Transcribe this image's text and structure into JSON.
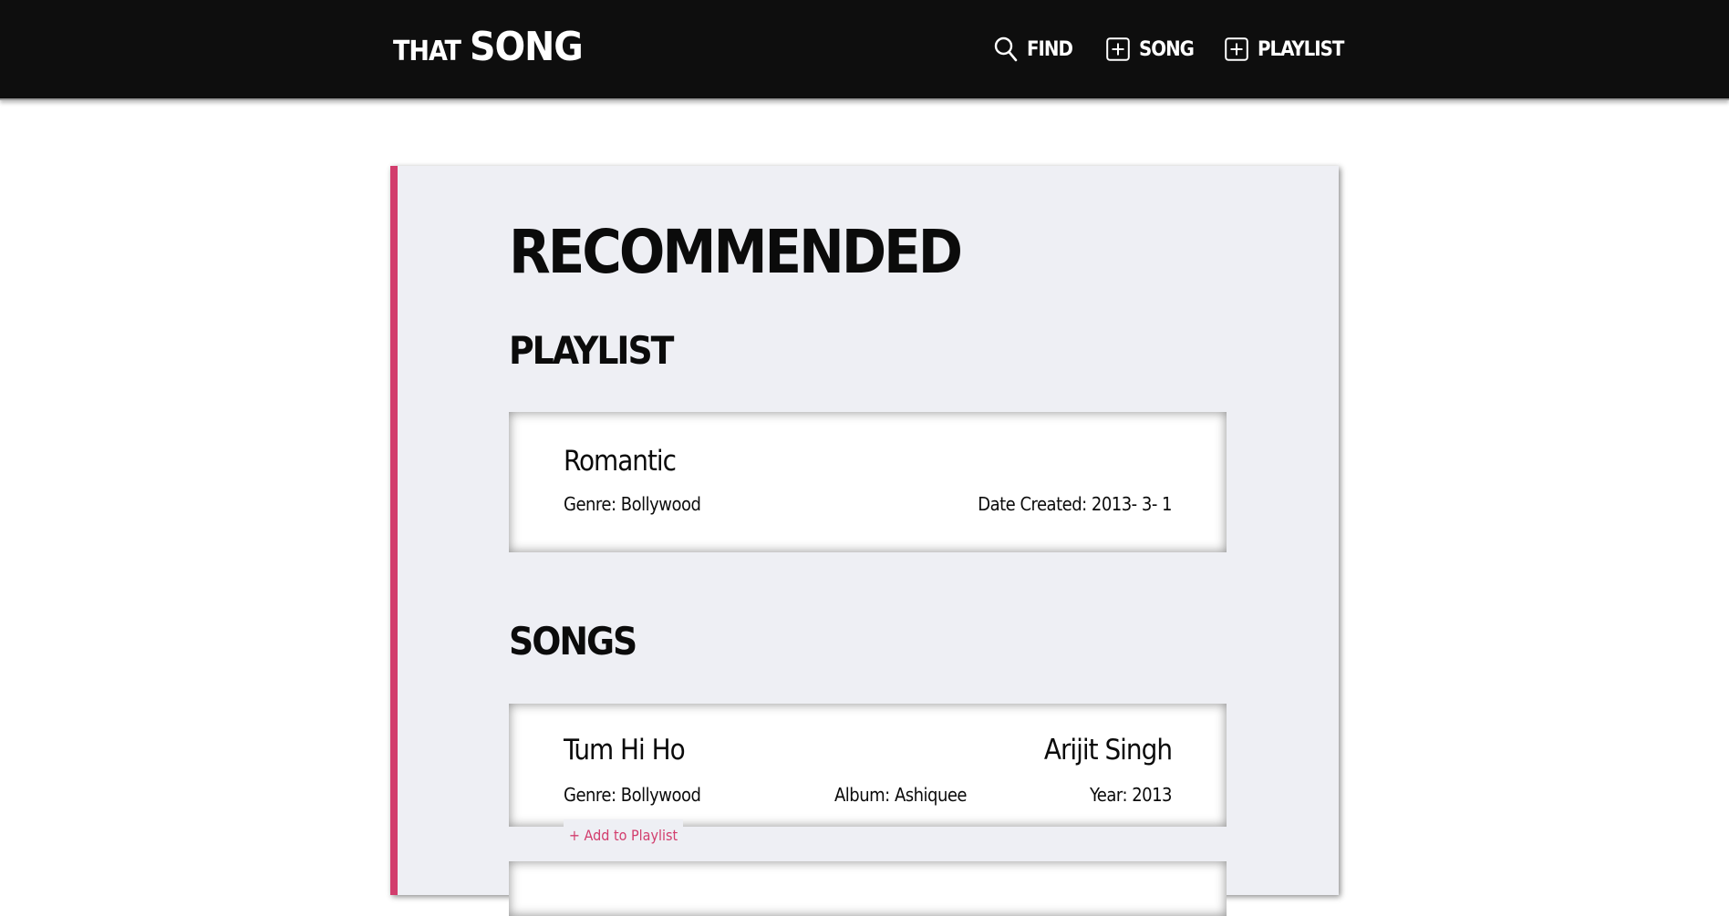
{
  "brand": {
    "small": "THAT",
    "big": "SONG"
  },
  "nav": {
    "find": {
      "label": "FIND",
      "icon": "search-icon"
    },
    "song": {
      "label": "SONG",
      "icon": "plus-square-icon"
    },
    "playlist": {
      "label": "PLAYLIST",
      "icon": "plus-square-icon"
    }
  },
  "colors": {
    "navbar": "#0e0e0e",
    "accent": "#d23d6d",
    "panel": "#eeeff4",
    "card": "#ffffff"
  },
  "main": {
    "heading": "RECOMMENDED",
    "playlist_heading": "PLAYLIST",
    "songs_heading": "SONGS"
  },
  "playlists": [
    {
      "name": "Romantic",
      "genre": "Genre: Bollywood",
      "date_created": "Date Created: 2013- 3- 1"
    }
  ],
  "songs": [
    {
      "title": "Tum Hi Ho",
      "artist": "Arijit Singh",
      "genre": "Genre: Bollywood",
      "album": "Album: Ashiquee",
      "year": "Year: 2013",
      "add_label": "+ Add to Playlist"
    }
  ]
}
